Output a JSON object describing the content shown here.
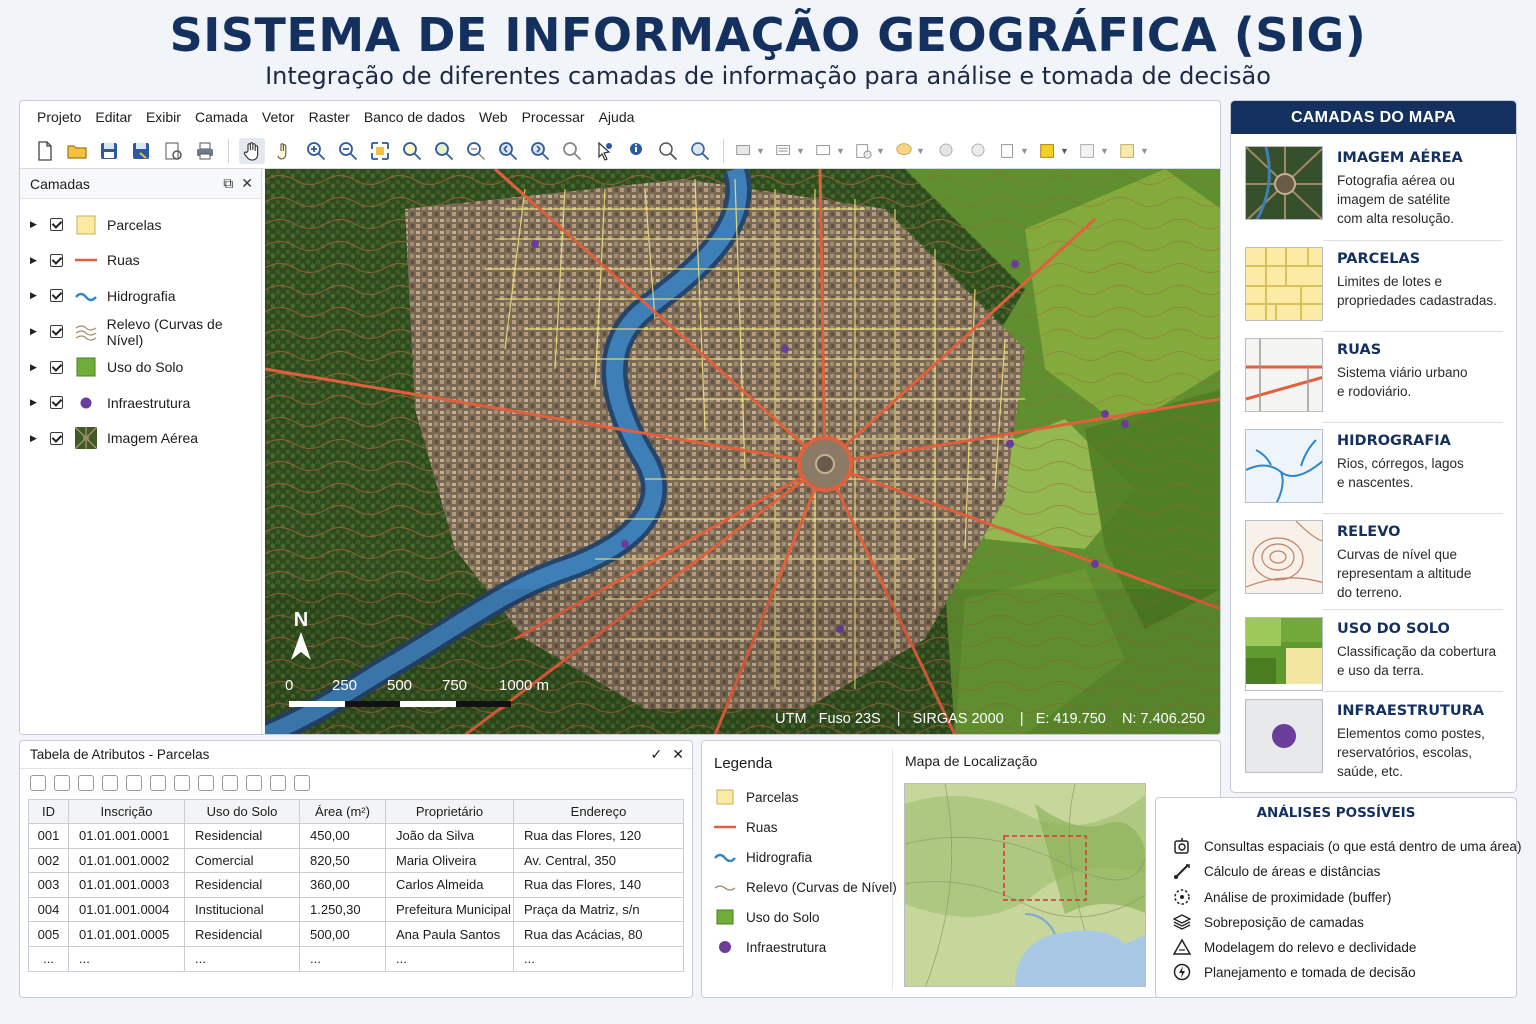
{
  "header": {
    "title": "SISTEMA DE INFORMAÇÃO GEOGRÁFICA (SIG)",
    "subtitle": "Integração de diferentes camadas de informação para análise e tomada de decisão"
  },
  "menubar": [
    "Projeto",
    "Editar",
    "Exibir",
    "Camada",
    "Vetor",
    "Raster",
    "Banco de dados",
    "Web",
    "Processar",
    "Ajuda"
  ],
  "layers_panel": {
    "title": "Camadas",
    "layers": [
      {
        "label": "Parcelas",
        "icon": "parcel-icon"
      },
      {
        "label": "Ruas",
        "icon": "road-line-icon"
      },
      {
        "label": "Hidrografia",
        "icon": "water-wave-icon"
      },
      {
        "label": "Relevo (Curvas de Nível)",
        "icon": "contour-icon"
      },
      {
        "label": "Uso do Solo",
        "icon": "land-use-icon"
      },
      {
        "label": "Infraestrutura",
        "icon": "point-icon"
      },
      {
        "label": "Imagem Aérea",
        "icon": "raster-icon"
      }
    ]
  },
  "map": {
    "north_label": "N",
    "scale_labels": [
      "0",
      "250",
      "500",
      "750",
      "1000  m"
    ],
    "status": "UTM   Fuso 23S    |   SIRGAS 2000    |   E: 419.750    N: 7.406.250"
  },
  "layers_guide": {
    "title": "CAMADAS DO MAPA",
    "items": [
      {
        "title": "IMAGEM AÉREA",
        "desc": [
          "Fotografia aérea ou",
          "imagem de satélite",
          "com alta resolução."
        ]
      },
      {
        "title": "PARCELAS",
        "desc": [
          "Limites de lotes e",
          "propriedades cadastradas."
        ]
      },
      {
        "title": "RUAS",
        "desc": [
          "Sistema viário urbano",
          "e rodoviário."
        ]
      },
      {
        "title": "HIDROGRAFIA",
        "desc": [
          "Rios, córregos, lagos",
          "e nascentes."
        ]
      },
      {
        "title": "RELEVO",
        "desc": [
          "Curvas de nível que",
          "representam a altitude",
          "do terreno."
        ]
      },
      {
        "title": "USO DO SOLO",
        "desc": [
          "Classificação da cobertura",
          "e uso da terra."
        ]
      },
      {
        "title": "INFRAESTRUTURA",
        "desc": [
          "Elementos como postes,",
          "reservatórios, escolas,",
          "saúde, etc."
        ]
      }
    ]
  },
  "attribute_table": {
    "title": "Tabela de Atributos - Parcelas",
    "columns": [
      "ID",
      "Inscrição",
      "Uso do Solo",
      "Área (m²)",
      "Proprietário",
      "Endereço"
    ],
    "rows": [
      [
        "001",
        "01.01.001.0001",
        "Residencial",
        "450,00",
        "João da Silva",
        "Rua das Flores, 120"
      ],
      [
        "002",
        "01.01.001.0002",
        "Comercial",
        "820,50",
        "Maria Oliveira",
        "Av. Central, 350"
      ],
      [
        "003",
        "01.01.001.0003",
        "Residencial",
        "360,00",
        "Carlos Almeida",
        "Rua das Flores, 140"
      ],
      [
        "004",
        "01.01.001.0004",
        "Institucional",
        "1.250,30",
        "Prefeitura Municipal",
        "Praça da Matriz, s/n"
      ],
      [
        "005",
        "01.01.001.0005",
        "Residencial",
        "500,00",
        "Ana Paula Santos",
        "Rua das Acácias, 80"
      ],
      [
        "...",
        "...",
        "...",
        "...",
        "...",
        "..."
      ]
    ]
  },
  "legend": {
    "title": "Legenda",
    "items": [
      "Parcelas",
      "Ruas",
      "Hidrografia",
      "Relevo (Curvas de Nível)",
      "Uso do Solo",
      "Infraestrutura"
    ]
  },
  "locator": {
    "title": "Mapa de Localização"
  },
  "analyses": {
    "title": "ANÁLISES POSSÍVEIS",
    "items": [
      {
        "label": "Consultas espaciais (o que está dentro de uma área)",
        "icon": "query-icon"
      },
      {
        "label": "Cálculo de áreas e distâncias",
        "icon": "measure-icon"
      },
      {
        "label": "Análise de proximidade (buffer)",
        "icon": "buffer-icon"
      },
      {
        "label": "Sobreposição de camadas",
        "icon": "layers-stack-icon"
      },
      {
        "label": "Modelagem do relevo e declividade",
        "icon": "terrain-icon"
      },
      {
        "label": "Planejamento e tomada de decisão",
        "icon": "decision-icon"
      }
    ]
  },
  "colors": {
    "brand_navy": "#14305f",
    "road": "#e0603c",
    "parcel": "#f2e27a",
    "water": "#3f7fb8",
    "vegetation": "#4f7a2a",
    "infrastructure": "#6a3d9a"
  }
}
